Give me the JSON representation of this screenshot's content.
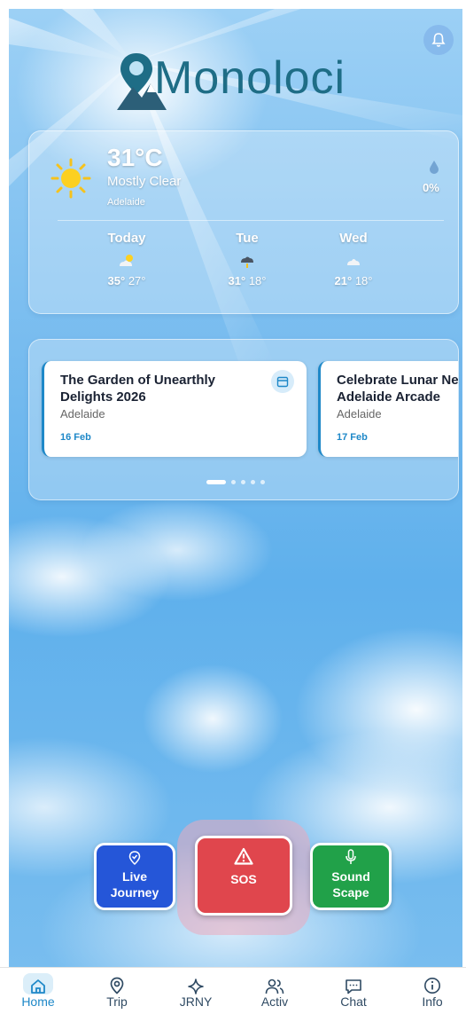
{
  "header": {
    "logo_text": "Monoloci",
    "notification_icon": "bell-icon"
  },
  "weather": {
    "temperature": "31°C",
    "condition": "Mostly Clear",
    "location": "Adelaide",
    "precip_chance": "0%",
    "forecast": [
      {
        "day": "Today",
        "icon": "partly-cloudy-icon",
        "high": "35°",
        "low": "27°"
      },
      {
        "day": "Tue",
        "icon": "rain-cloud-icon",
        "high": "31°",
        "low": "18°"
      },
      {
        "day": "Wed",
        "icon": "cloud-icon",
        "high": "21°",
        "low": "18°"
      }
    ]
  },
  "events": {
    "items": [
      {
        "title": "The Garden of Unearthly Delights 2026",
        "location": "Adelaide",
        "date": "16 Feb"
      },
      {
        "title": "Celebrate Lunar New Year at Adelaide Arcade",
        "location": "Adelaide",
        "date": "17 Feb"
      }
    ],
    "page_count": 5,
    "active_page": 1
  },
  "actions": {
    "live_journey": {
      "label": "Live Journey",
      "color": "#2556d8"
    },
    "sos": {
      "label": "SOS",
      "color": "#e0464d"
    },
    "sound_scape": {
      "label": "Sound Scape",
      "color": "#21a149"
    }
  },
  "nav": {
    "items": [
      {
        "label": "Home",
        "icon": "home-icon",
        "active": true
      },
      {
        "label": "Trip",
        "icon": "map-pin-icon",
        "active": false
      },
      {
        "label": "JRNY",
        "icon": "sparkle-icon",
        "active": false
      },
      {
        "label": "Activ",
        "icon": "users-icon",
        "active": false
      },
      {
        "label": "Chat",
        "icon": "chat-icon",
        "active": false
      },
      {
        "label": "Info",
        "icon": "info-icon",
        "active": false
      }
    ]
  }
}
